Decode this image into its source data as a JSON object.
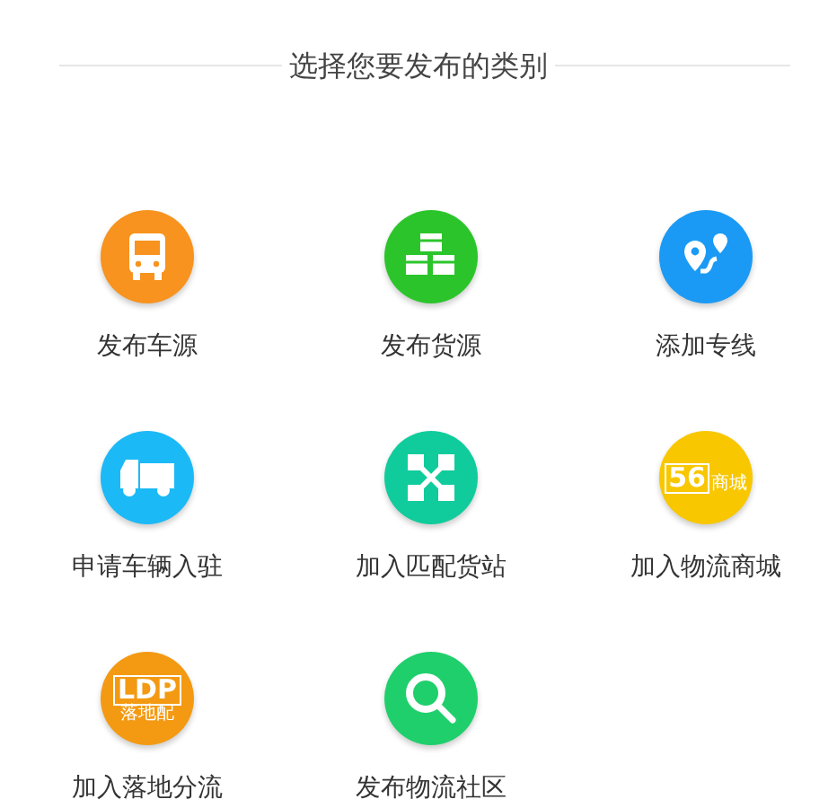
{
  "header": {
    "title": "选择您要发布的类别"
  },
  "categories": [
    {
      "kind": "bus",
      "color": "#f7931e",
      "label": "发布车源"
    },
    {
      "kind": "boxes",
      "color": "#2bc52b",
      "label": "发布货源"
    },
    {
      "kind": "route",
      "color": "#1a9af5",
      "label": "添加专线"
    },
    {
      "kind": "truck",
      "color": "#1cb9f7",
      "label": "申请车辆入驻"
    },
    {
      "kind": "hub",
      "color": "#10cc9c",
      "label": "加入匹配货站"
    },
    {
      "kind": "shop",
      "color": "#f8c700",
      "label": "加入物流商城",
      "logo_texts": [
        "56",
        "商城"
      ]
    },
    {
      "kind": "ldp",
      "color": "#f39a12",
      "label": "加入落地分流",
      "logo_texts": [
        "LDP",
        "落地配"
      ]
    },
    {
      "kind": "search",
      "color": "#1fcf6c",
      "label": "发布物流社区"
    }
  ]
}
